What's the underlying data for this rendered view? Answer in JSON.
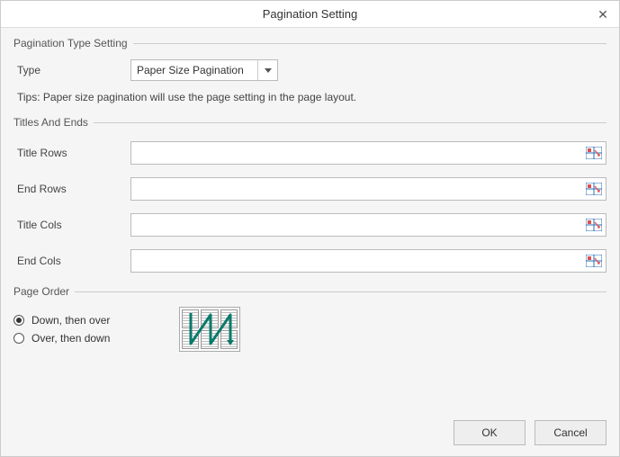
{
  "dialog": {
    "title": "Pagination Setting"
  },
  "groups": {
    "typeSetting": {
      "legend": "Pagination Type Setting"
    },
    "titlesEnds": {
      "legend": "Titles And Ends"
    },
    "pageOrder": {
      "legend": "Page Order"
    }
  },
  "type": {
    "label": "Type",
    "selected": "Paper Size Pagination"
  },
  "tips": "Tips: Paper size pagination will use the page setting in the page layout.",
  "fields": {
    "titleRows": {
      "label": "Title Rows",
      "value": ""
    },
    "endRows": {
      "label": "End Rows",
      "value": ""
    },
    "titleCols": {
      "label": "Title Cols",
      "value": ""
    },
    "endCols": {
      "label": "End Cols",
      "value": ""
    }
  },
  "order": {
    "downThenOver": {
      "label": "Down, then over",
      "checked": true
    },
    "overThenDown": {
      "label": "Over, then down",
      "checked": false
    }
  },
  "buttons": {
    "ok": "OK",
    "cancel": "Cancel"
  }
}
